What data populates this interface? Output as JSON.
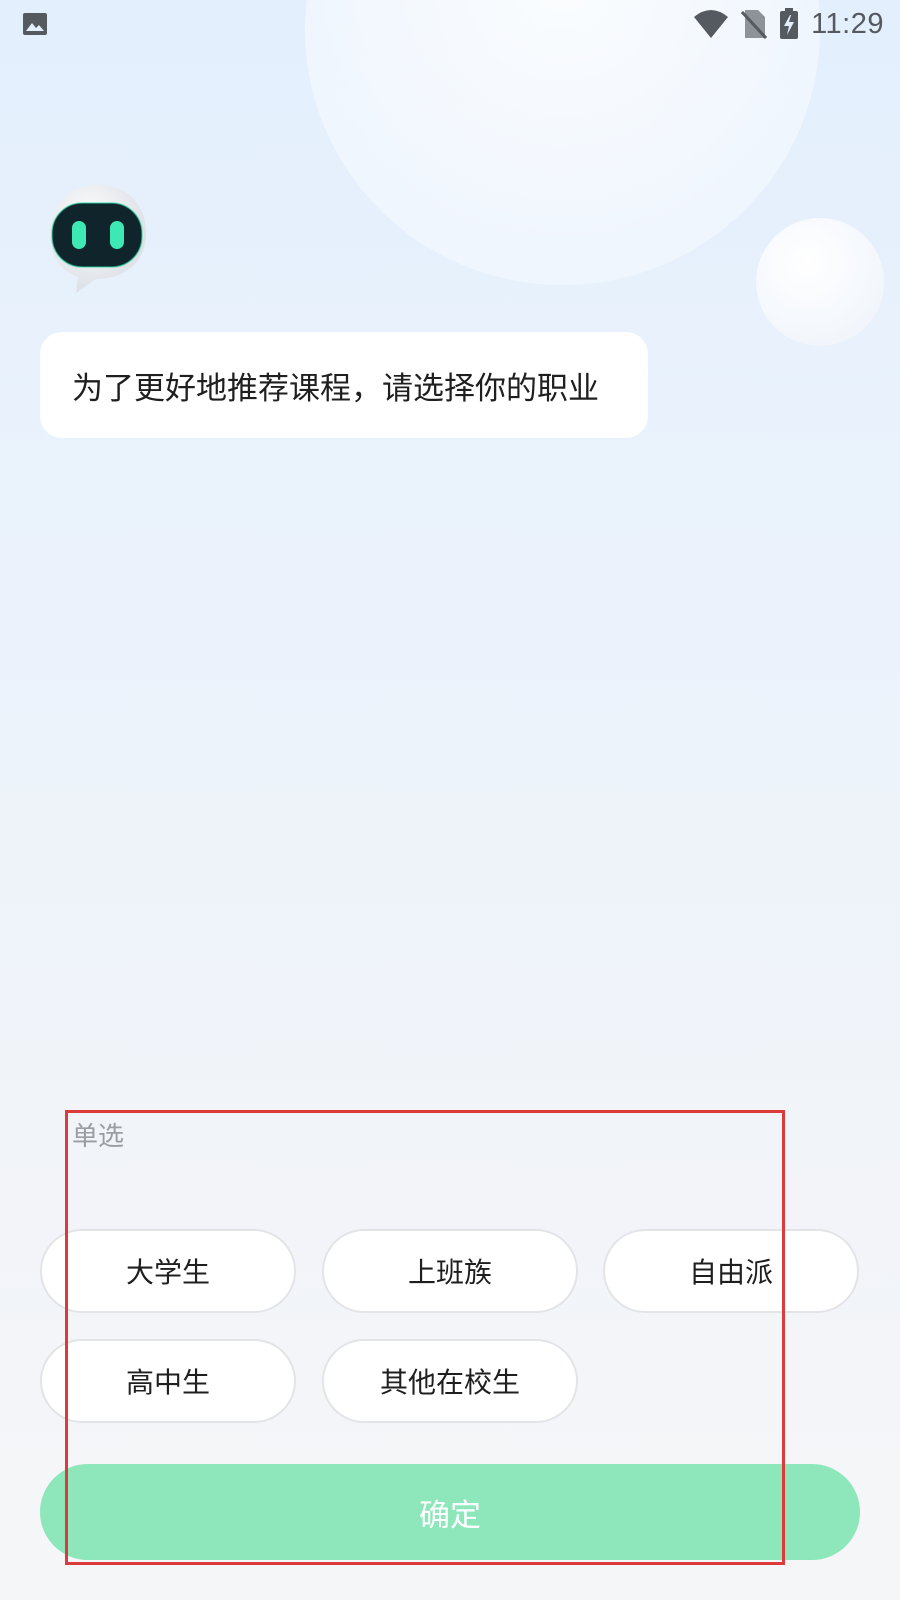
{
  "status_bar": {
    "time": "11:29",
    "left_icon": "image-icon",
    "icons": [
      "wifi-icon",
      "no-sim-icon",
      "battery-charging-icon"
    ]
  },
  "chat": {
    "avatar_icon": "robot-avatar-icon",
    "message": "为了更好地推荐课程，请选择你的职业"
  },
  "selector": {
    "mode_label": "单选",
    "options": [
      "大学生",
      "上班族",
      "自由派",
      "高中生",
      "其他在校生"
    ],
    "confirm_label": "确定"
  },
  "colors": {
    "confirm_bg": "#8ee6bb",
    "highlight_frame": "#db3b3b",
    "robot_eyes": "#3ee8b5"
  }
}
